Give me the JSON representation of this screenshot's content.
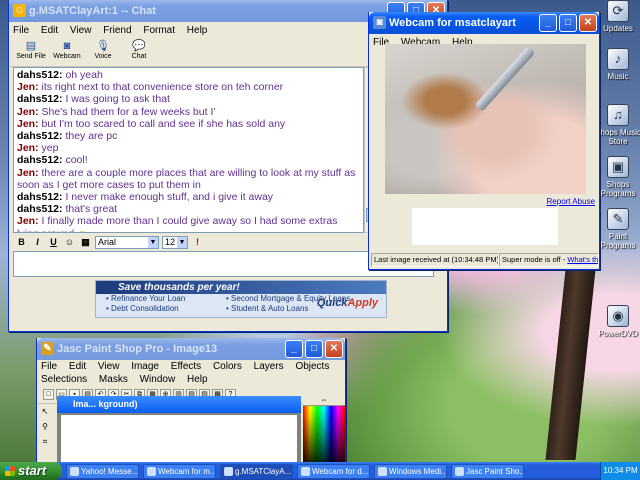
{
  "desktop": {
    "icons": [
      {
        "label": "Updates",
        "icon": "windows-update-icon"
      },
      {
        "label": "Music",
        "icon": "music-note-icon"
      },
      {
        "label": "Shops Music Store",
        "icon": "music-store-icon"
      },
      {
        "label": "Shops Programs",
        "icon": "programs-icon"
      },
      {
        "label": "Paint Programs",
        "icon": "paint-icon"
      },
      {
        "label": "PowerDVD",
        "icon": "dvd-icon"
      }
    ]
  },
  "chat_window": {
    "title": "g.MSATClayArt:1 -- Chat",
    "menu": [
      "File",
      "Edit",
      "View",
      "Friend",
      "Format",
      "Help"
    ],
    "toolbar": [
      {
        "label": "Send File",
        "icon": "send-file-icon"
      },
      {
        "label": "Webcam",
        "icon": "webcam-icon"
      },
      {
        "label": "Voice",
        "icon": "microphone-icon"
      },
      {
        "label": "Chat",
        "icon": "chat-bubble-icon"
      }
    ],
    "messages": [
      {
        "sender": "dahs512:",
        "text": "oh yeah"
      },
      {
        "sender": "Jen:",
        "text": "its right next to that convenience store on teh corner"
      },
      {
        "sender": "dahs512:",
        "text": "I was going to ask that"
      },
      {
        "sender": "Jen:",
        "text": "She's had them for a few weeks but I'"
      },
      {
        "sender": "Jen:",
        "text": "but I'm too scared to call and see if she has sold any"
      },
      {
        "sender": "dahs512:",
        "text": "they are pc"
      },
      {
        "sender": "Jen:",
        "text": "yep"
      },
      {
        "sender": "dahs512:",
        "text": "cool!"
      },
      {
        "sender": "Jen:",
        "text": "there are a couple more places that are willing to look at my stuff as soon as I get more cases to put them in"
      },
      {
        "sender": "dahs512:",
        "text": "I never make enough stuff, and i give it away"
      },
      {
        "sender": "dahs512:",
        "text": "that's great"
      },
      {
        "sender": "Jen:",
        "text": "I finally made more than I could give away so I had some extras lying around"
      }
    ],
    "format": {
      "font": "Arial",
      "size": "12"
    },
    "ad": {
      "headline": "Save thousands per year!",
      "items": [
        "Refinance Your Loan",
        "Second Mortgage & Equity Loans",
        "Debt Consolidation",
        "Student & Auto Loans"
      ],
      "brand_a": "Quick",
      "brand_b": "Apply"
    }
  },
  "webcam_window": {
    "title": "Webcam for msatclayart",
    "menu": [
      "File",
      "Webcam",
      "Help"
    ],
    "report_link": "Report Abuse",
    "status_left": "Last image received at (10:34:48 PM)",
    "status_right_text": "Super mode is off -",
    "status_right_link": "What's this?"
  },
  "psp_window": {
    "title": "Jasc Paint Shop Pro - Image13",
    "menu": [
      "File",
      "Edit",
      "View",
      "Image",
      "Effects",
      "Colors",
      "Layers",
      "Objects",
      "Selections",
      "Masks",
      "Window",
      "Help"
    ],
    "doc_title": "Ima... kground)"
  },
  "taskbar": {
    "start_label": "start",
    "tasks": [
      "Yahoo! Messe...",
      "Webcam for m...",
      "g.MSATClayA...",
      "Webcam for d...",
      "Windows Medi...",
      "Jasc Paint Sho..."
    ],
    "clock": "10:34 PM"
  },
  "colors": {
    "xp_title_blue": "#0a5ef0",
    "sender_dahs": "#000000",
    "sender_jen": "#800000",
    "message_text": "#62318f",
    "taskbar_blue": "#245edc",
    "start_green": "#2f8a2d"
  }
}
